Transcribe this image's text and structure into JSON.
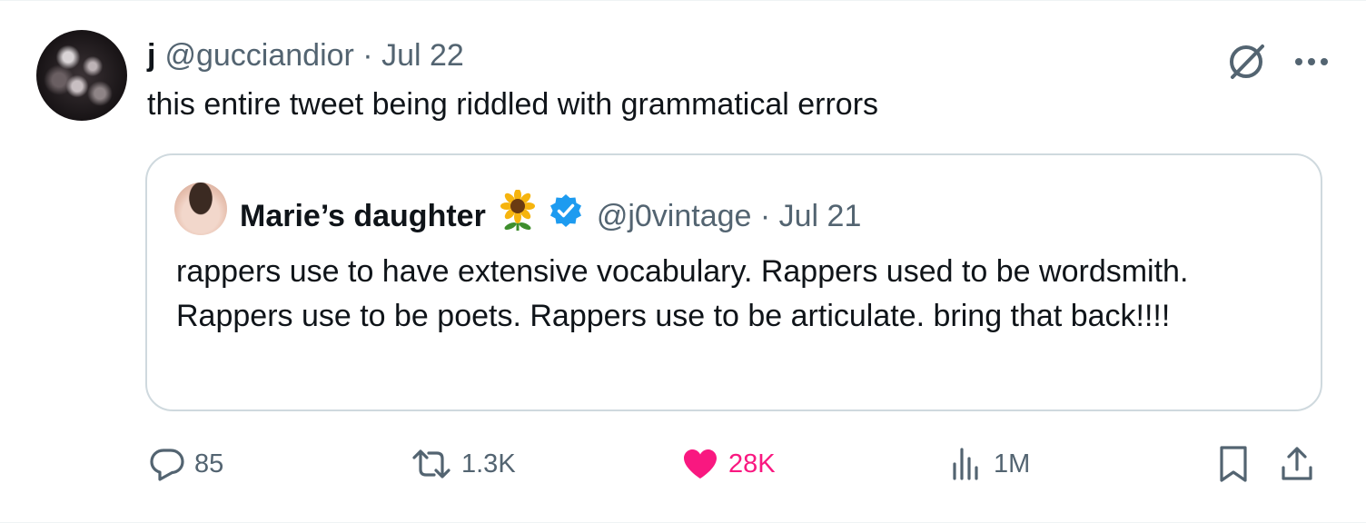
{
  "tweet": {
    "author_name": "j",
    "author_meta": "@gucciandior · Jul 22",
    "text": "this entire tweet being riddled with grammatical errors",
    "avatar_icon": "avatar-image",
    "top_icons": [
      "grok-icon",
      "more-icon"
    ]
  },
  "quote": {
    "author_name": "Marie’s daughter",
    "emoji_icon": "sunflower-icon",
    "verified_icon": "verified-badge-icon",
    "verified_color": "#1d9bf0",
    "author_meta": "@j0vintage · Jul 21",
    "text": "rappers use to have extensive vocabulary. Rappers used to be wordsmith. Rappers use to be poets. Rappers use to be articulate. bring that back!!!!"
  },
  "actions": {
    "replies": "85",
    "reposts": "1.3K",
    "likes": "28K",
    "views": "1M",
    "like_color": "#f91880",
    "muted_color": "#536471"
  }
}
